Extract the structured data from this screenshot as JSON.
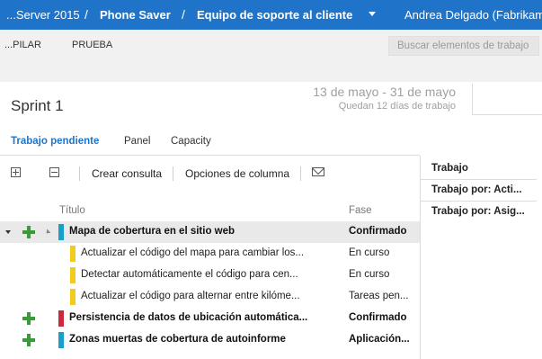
{
  "topbar": {
    "server": "...Server 2015",
    "project": "Phone Saver",
    "team": "Equipo de soporte al cliente",
    "user": "Andrea Delgado (Fabrikam)",
    "separator": "/"
  },
  "hub": {
    "items": [
      "...PILAR",
      "PRUEBA"
    ],
    "search_placeholder": "Buscar elementos de trabajo"
  },
  "sprint": {
    "title": "Sprint 1",
    "dates": "13 de mayo - 31 de mayo",
    "remaining": "Quedan 12 días de trabajo"
  },
  "tabs": [
    {
      "label": "Trabajo pendiente",
      "active": true
    },
    {
      "label": "Panel",
      "active": false
    },
    {
      "label": "Capacity",
      "active": false
    }
  ],
  "toolbar": {
    "create_query": "Crear consulta",
    "column_options": "Opciones de columna"
  },
  "columns": {
    "title": "Título",
    "phase": "Fase"
  },
  "rows": [
    {
      "title": "Mapa de cobertura en el sitio web",
      "phase": "Confirmado",
      "kind": "parent",
      "color": "#1aa0c8"
    },
    {
      "title": "Actualizar el código del mapa para cambiar los...",
      "phase": "En curso",
      "kind": "child",
      "color": "#f2cb1d"
    },
    {
      "title": "Detectar automáticamente el código para cen...",
      "phase": "En curso",
      "kind": "child",
      "color": "#f2cb1d"
    },
    {
      "title": "Actualizar el código para alternar entre kilóme...",
      "phase": "Tareas pen...",
      "kind": "child",
      "color": "#f2cb1d"
    },
    {
      "title": "Persistencia de datos de ubicación automática...",
      "phase": "Confirmado",
      "kind": "parent",
      "color": "#cc293d"
    },
    {
      "title": "Zonas muertas de cobertura de autoinforme",
      "phase": "Aplicación...",
      "kind": "parent",
      "color": "#1aa0c8"
    }
  ],
  "right_pane": {
    "items": [
      "Trabajo",
      "Trabajo por: Acti...",
      "Trabajo por: Asig..."
    ]
  },
  "colors": {
    "accent": "#1f74c9",
    "green": "#3a9a3a",
    "story": "#1aa0c8",
    "task": "#f2cb1d",
    "bug": "#cc293d"
  }
}
